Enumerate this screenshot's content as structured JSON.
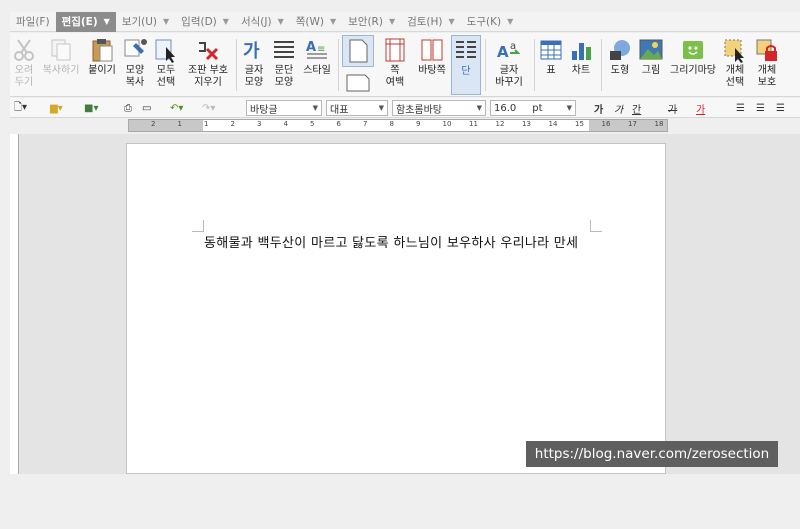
{
  "menubar": {
    "items": [
      {
        "label": "파일(F)"
      },
      {
        "label": "편집(E)"
      },
      {
        "label": "보기(U)"
      },
      {
        "label": "입력(D)"
      },
      {
        "label": "서식(J)"
      },
      {
        "label": "쪽(W)"
      },
      {
        "label": "보안(R)"
      },
      {
        "label": "검토(H)"
      },
      {
        "label": "도구(K)"
      }
    ]
  },
  "ribbon": {
    "cut": "오려\n두기",
    "copy": "복사하기",
    "paste": "붙이기",
    "format_copy": "모양\n복사",
    "select_all": "모두\n선택",
    "clear_codes": "조판 부호\n지우기",
    "char_shape": "글자\n모양",
    "para_shape": "문단\n모양",
    "style": "스타일",
    "page_margin": "쪽\n여백",
    "page_bg": "바탕쪽",
    "columns": "단",
    "char_replace": "글자\n바꾸기",
    "table": "표",
    "chart": "차트",
    "shape": "도형",
    "picture": "그림",
    "draw_market": "그리기마당",
    "object_select": "개체\n선택",
    "object_protect": "개체\n보호"
  },
  "formatbar": {
    "style_value": "바탕글",
    "lang_value": "대표",
    "font_value": "함초롬바탕",
    "size_value": "16.0",
    "size_unit": "pt",
    "bold_glyph": "가",
    "italic_glyph": "가",
    "underline_glyph": "간",
    "strike_glyph": "가",
    "color_glyph": "가"
  },
  "ruler": {
    "numbers": [
      "2",
      "1",
      "1",
      "2",
      "3",
      "4",
      "5",
      "6",
      "7",
      "8",
      "9",
      "10",
      "11",
      "12",
      "13",
      "14",
      "15",
      "16",
      "17",
      "18"
    ]
  },
  "document": {
    "text": "동해물과 백두산이 마르고 닳도록 하느님이 보우하사 우리나라 만세"
  },
  "watermark": {
    "text": "https://blog.naver.com/zerosection"
  },
  "colors": {
    "accent": "#8c8c8c",
    "selected_tool_bg": "#dbe6f4"
  }
}
